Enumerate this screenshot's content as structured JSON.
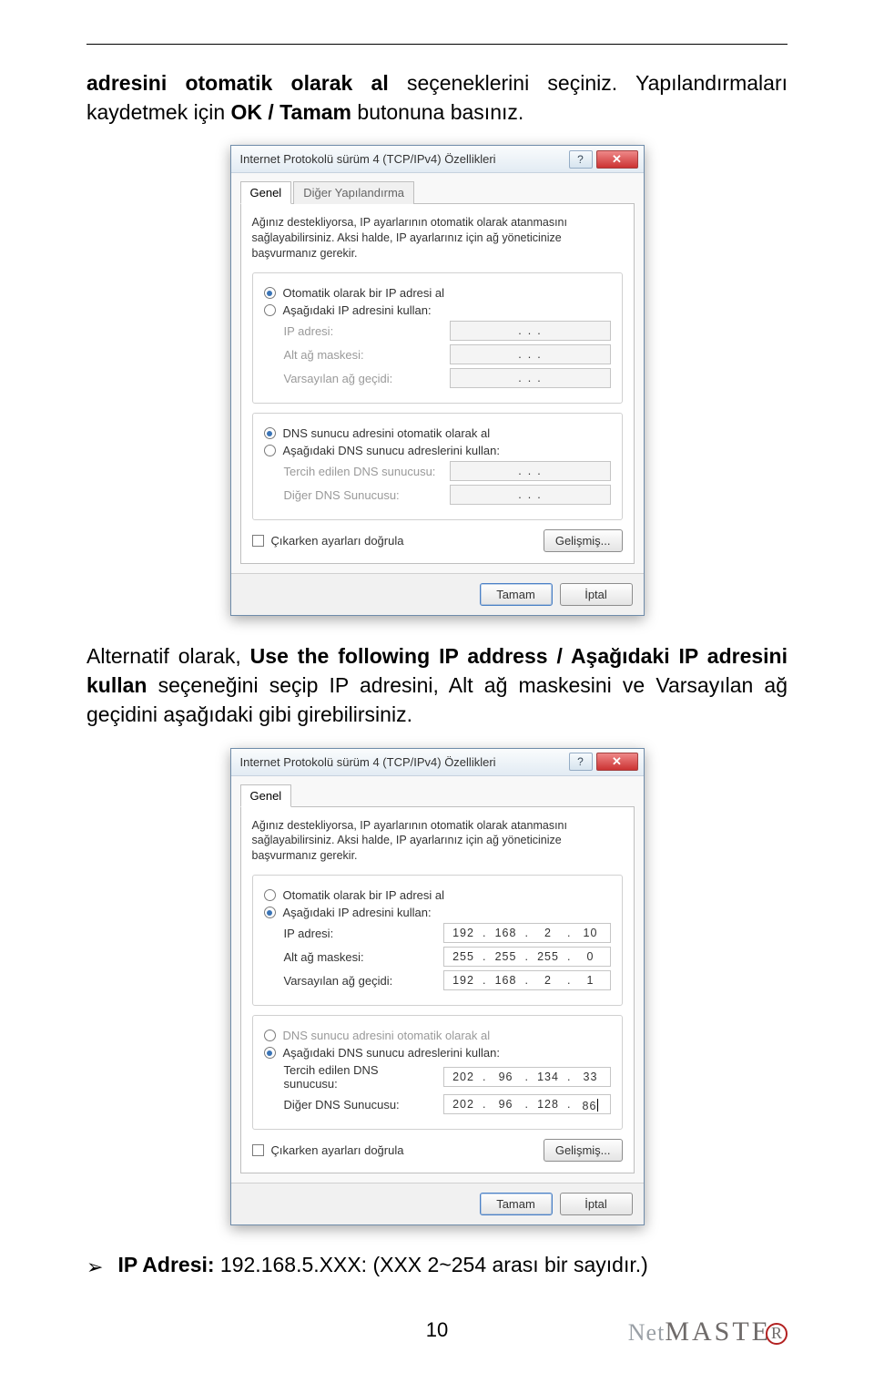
{
  "para1": {
    "pre": "adresini otomatik olarak al",
    "post": " seçeneklerini seçiniz. Yapılandırmaları kaydetmek için ",
    "ok": "OK / Tamam",
    "tail": " butonuna basınız."
  },
  "para2": {
    "pre": "Alternatif olarak, ",
    "uf": "Use the following IP address / Aşağıdaki IP adresini kullan",
    "post": " seçeneğini seçip IP adresini, Alt ağ maskesini ve Varsayılan ağ geçidini aşağıdaki gibi girebilirsiniz."
  },
  "bullet": {
    "label": "IP Adresi:",
    "value": " 192.168.5.XXX: (XXX 2~254 arası bir sayıdır.)"
  },
  "pagenum": "10",
  "logo": {
    "net": "Net",
    "master": "MASTE",
    "r": "R"
  },
  "dlg": {
    "title": "Internet Protokolü sürüm 4 (TCP/IPv4) Özellikleri",
    "tab_general": "Genel",
    "tab_alt": "Diğer Yapılandırma",
    "intro": "Ağınız destekliyorsa, IP ayarlarının otomatik olarak atanmasını sağlayabilirsiniz. Aksi halde, IP ayarlarınız için ağ yöneticinize başvurmanız gerekir.",
    "ip_auto": "Otomatik olarak bir IP adresi al",
    "ip_manual": "Aşağıdaki IP adresini kullan:",
    "label_ip": "IP adresi:",
    "label_mask": "Alt ağ maskesi:",
    "label_gw": "Varsayılan ağ geçidi:",
    "dns_auto": "DNS sunucu adresini otomatik olarak al",
    "dns_manual": "Aşağıdaki DNS sunucu adreslerini kullan:",
    "label_dns1": "Tercih edilen DNS sunucusu:",
    "label_dns2": "Diğer DNS Sunucusu:",
    "validate": "Çıkarken ayarları doğrula",
    "advanced": "Gelişmiş...",
    "ok": "Tamam",
    "cancel": "İptal"
  },
  "dlg2_values": {
    "ip": [
      "192",
      "168",
      "2",
      "10"
    ],
    "mask": [
      "255",
      "255",
      "255",
      "0"
    ],
    "gw": [
      "192",
      "168",
      "2",
      "1"
    ],
    "dns1": [
      "202",
      "96",
      "134",
      "33"
    ],
    "dns2": [
      "202",
      "96",
      "128",
      "86"
    ]
  }
}
